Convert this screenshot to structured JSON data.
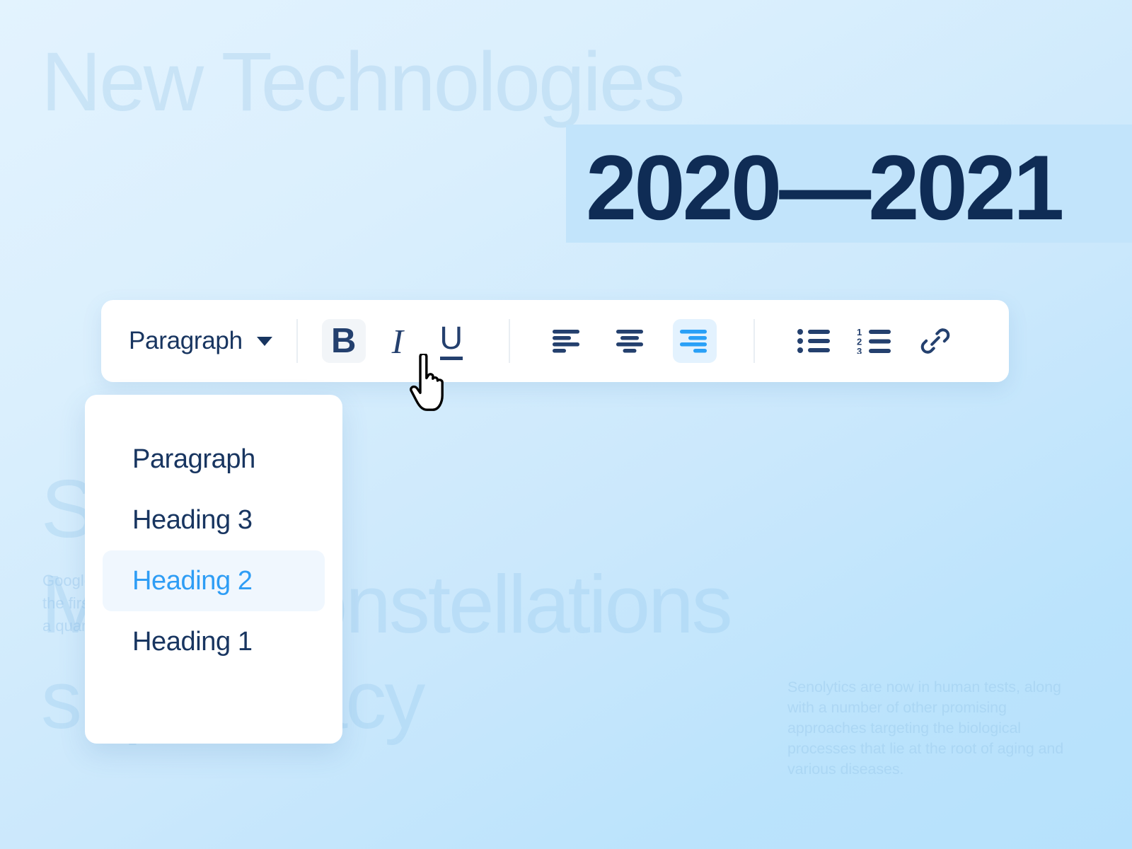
{
  "document": {
    "ghost_title": "New Technologies",
    "year_label": "2020—2021",
    "ghost_heading_line1": "Se ①",
    "ghost_heading_line2": "Mega-constellations",
    "ghost_heading_line3": "supremacy",
    "ghost_body_left": "Google\nthe firs\na quan",
    "ghost_body_right": "Senolytics are now in human tests, along with a number of other promising approaches targeting the biological processes that lie at the root of aging and various diseases."
  },
  "toolbar": {
    "style_select_label": "Paragraph",
    "buttons": [
      {
        "name": "bold",
        "glyph": "B",
        "state": "hover"
      },
      {
        "name": "italic",
        "glyph": "I",
        "state": "normal"
      },
      {
        "name": "underline",
        "glyph": "U",
        "state": "normal"
      },
      {
        "name": "align-left",
        "glyph": "",
        "state": "normal"
      },
      {
        "name": "align-center",
        "glyph": "",
        "state": "normal"
      },
      {
        "name": "align-right",
        "glyph": "",
        "state": "active"
      },
      {
        "name": "bullet-list",
        "glyph": "",
        "state": "normal"
      },
      {
        "name": "numbered-list",
        "glyph": "",
        "state": "normal"
      },
      {
        "name": "link",
        "glyph": "",
        "state": "normal"
      }
    ],
    "numbered_list_digits": [
      "1",
      "2",
      "3"
    ]
  },
  "dropdown": {
    "items": [
      {
        "label": "Paragraph",
        "selected": false
      },
      {
        "label": "Heading 3",
        "selected": false
      },
      {
        "label": "Heading 2",
        "selected": true
      },
      {
        "label": "Heading 1",
        "selected": false
      }
    ]
  },
  "colors": {
    "navy": "#0f2c55",
    "toolbar_icon": "#24406e",
    "accent_blue": "#29a0f7",
    "selected_blue": "#2e9df5",
    "highlight_block": "#c2e4fb",
    "selected_row_bg": "#f0f7fe",
    "hover_bg": "#f2f5f8",
    "panel_white": "#ffffff",
    "bg_top": "#e3f3fe",
    "bg_bottom": "#b6e1fc"
  },
  "cursor": {
    "type": "pointing-hand"
  }
}
